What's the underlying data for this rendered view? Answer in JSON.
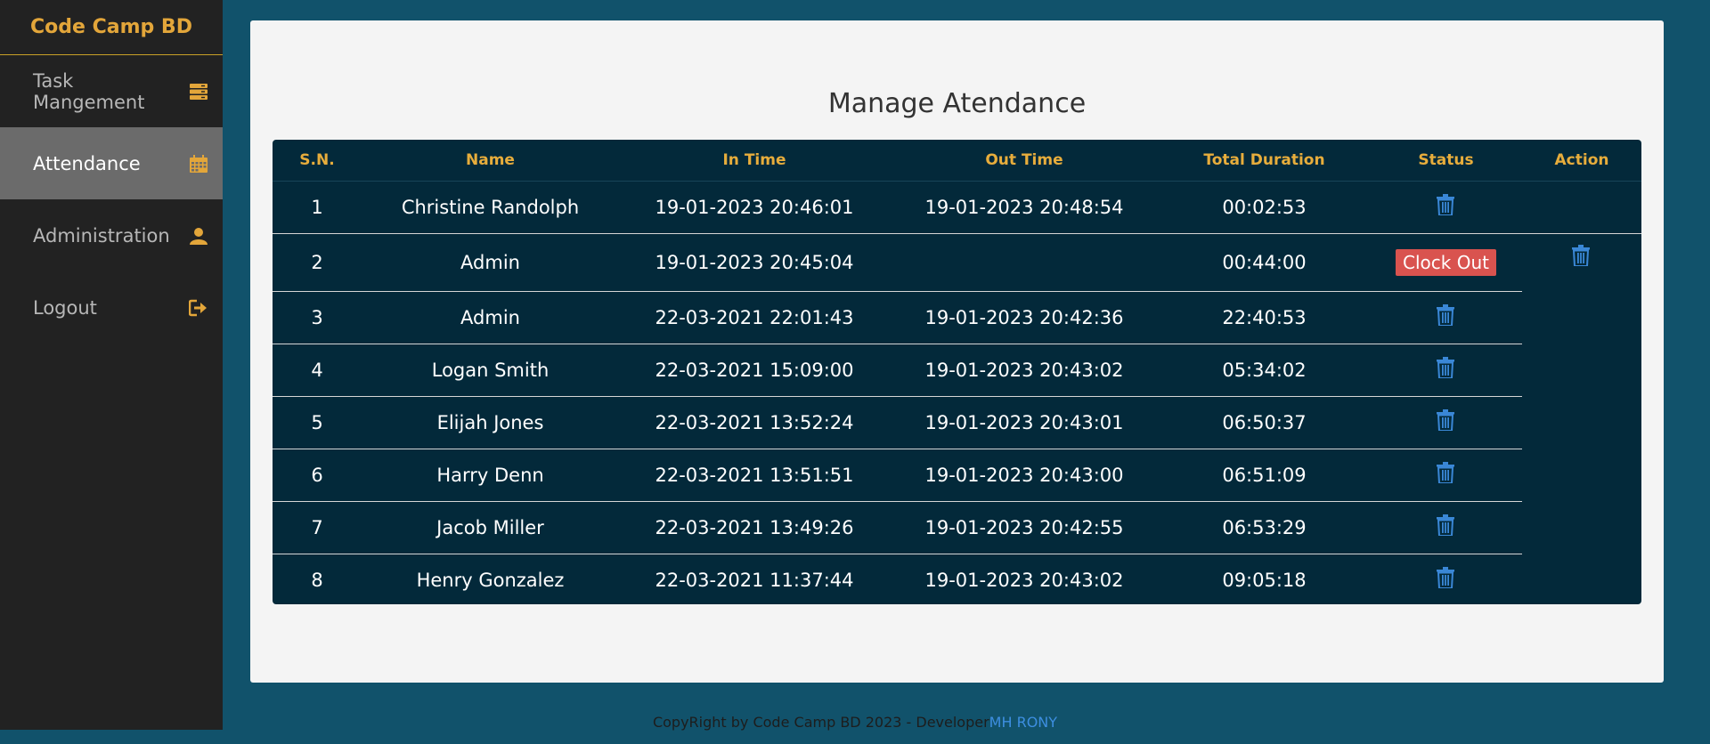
{
  "sidebar": {
    "brand": "Code Camp BD",
    "items": [
      {
        "label": "Task Mangement",
        "icon": "server-icon"
      },
      {
        "label": "Attendance",
        "icon": "calendar-icon",
        "active": true
      },
      {
        "label": "Administration",
        "icon": "user-icon"
      },
      {
        "label": "Logout",
        "icon": "logout-icon"
      }
    ]
  },
  "main": {
    "title": "Manage Atendance",
    "columns": [
      "S.N.",
      "Name",
      "In Time",
      "Out Time",
      "Total Duration",
      "Status",
      "Action"
    ],
    "rows": [
      {
        "sn": "1",
        "name": "Christine Randolph",
        "in": "19-01-2023 20:46:01",
        "out": "19-01-2023 20:48:54",
        "duration": "00:02:53"
      },
      {
        "sn": "2",
        "name": "Admin",
        "in": "19-01-2023 20:45:04",
        "out": "",
        "duration": "00:44:00",
        "status": "Clock Out"
      },
      {
        "sn": "3",
        "name": "Admin",
        "in": "22-03-2021 22:01:43",
        "out": "19-01-2023 20:42:36",
        "duration": "22:40:53"
      },
      {
        "sn": "4",
        "name": "Logan Smith",
        "in": "22-03-2021 15:09:00",
        "out": "19-01-2023 20:43:02",
        "duration": "05:34:02"
      },
      {
        "sn": "5",
        "name": "Elijah Jones",
        "in": "22-03-2021 13:52:24",
        "out": "19-01-2023 20:43:01",
        "duration": "06:50:37"
      },
      {
        "sn": "6",
        "name": "Harry Denn",
        "in": "22-03-2021 13:51:51",
        "out": "19-01-2023 20:43:00",
        "duration": "06:51:09"
      },
      {
        "sn": "7",
        "name": "Jacob Miller",
        "in": "22-03-2021 13:49:26",
        "out": "19-01-2023 20:42:55",
        "duration": "06:53:29"
      },
      {
        "sn": "8",
        "name": "Henry Gonzalez",
        "in": "22-03-2021 11:37:44",
        "out": "19-01-2023 20:43:02",
        "duration": "09:05:18"
      }
    ]
  },
  "footer": {
    "text": "CopyRight by Code Camp BD 2023 - Developer",
    "developer": "MH RONY"
  },
  "colors": {
    "background": "#11526b",
    "sidebar": "#222222",
    "accent": "#e3a63a",
    "table": "#03293a",
    "danger": "#d9534f",
    "link": "#3d8ee0"
  }
}
